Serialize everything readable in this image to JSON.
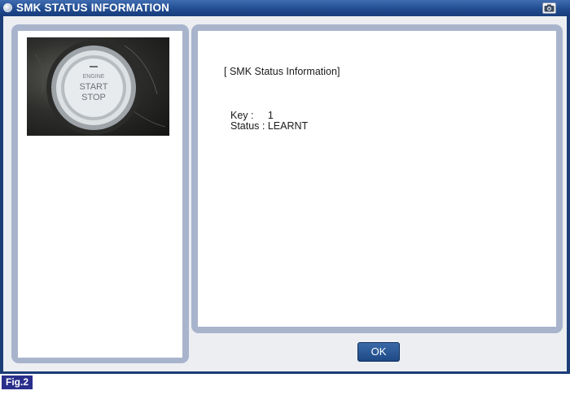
{
  "window": {
    "title": "SMK STATUS INFORMATION",
    "title_icon": "window-dot-icon",
    "capture_icon": "camera-icon"
  },
  "photo": {
    "button_text": [
      "ENGINE",
      "START",
      "STOP"
    ]
  },
  "status": {
    "header": "[ SMK Status Information]",
    "key_line": "Key :     1",
    "status_line": "Status : LEARNT"
  },
  "buttons": {
    "ok_label": "OK"
  },
  "figure": {
    "label": "Fig.2"
  },
  "colors": {
    "frame": "#1b3d78",
    "panel_border": "#a8b4cc",
    "ok_button": "#2b5b9a",
    "fig_label_bg": "#2a2f8c"
  }
}
